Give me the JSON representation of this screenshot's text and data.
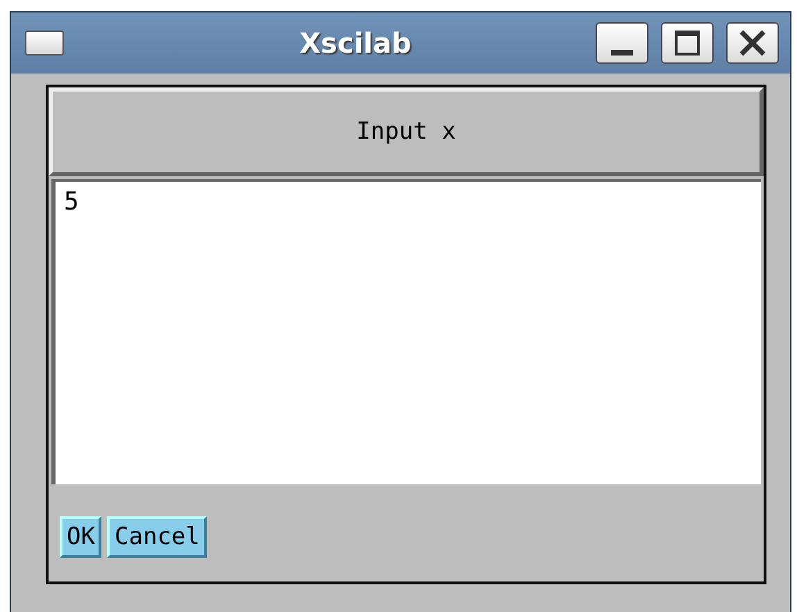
{
  "window": {
    "title": "Xscilab"
  },
  "dialog": {
    "prompt": "Input x",
    "value": "5"
  },
  "buttons": [
    "OK",
    "Cancel"
  ]
}
